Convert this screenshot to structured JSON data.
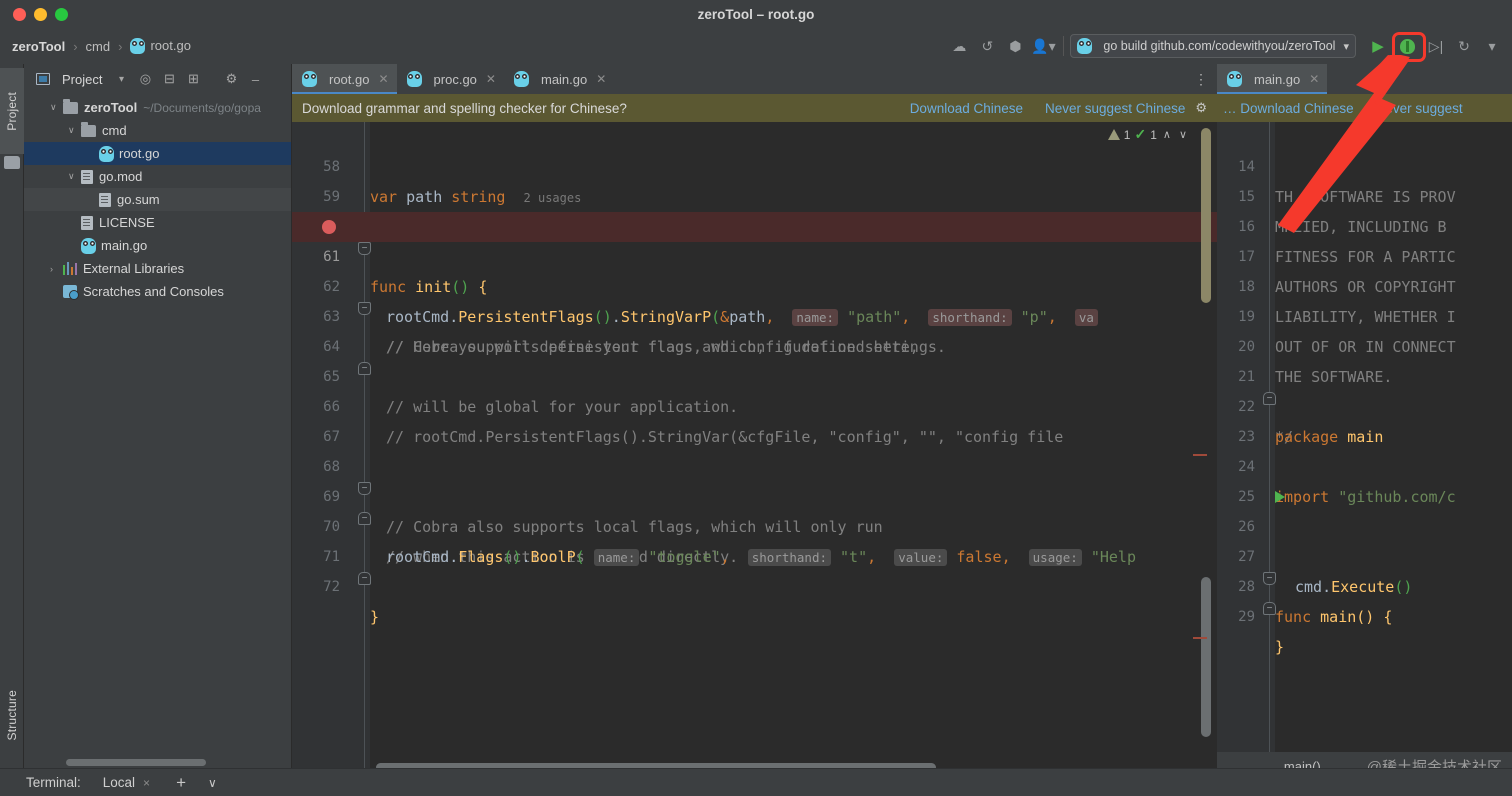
{
  "window": {
    "title": "zeroTool – root.go",
    "traffic_lights": [
      "close",
      "minimize",
      "maximize"
    ]
  },
  "breadcrumb": {
    "items": [
      {
        "label": "zeroTool",
        "icon": "none"
      },
      {
        "label": "cmd",
        "icon": "none"
      },
      {
        "label": "root.go",
        "icon": "go-file-icon"
      }
    ],
    "separator": "›"
  },
  "toolbar": {
    "icons": [
      "cloud-icon",
      "update-project-icon",
      "package-icon",
      "account-icon"
    ],
    "run_config": {
      "label": "go build github.com/codewithyou/zeroTool",
      "icon": "go-file-icon",
      "dropdown": "▾"
    },
    "run_button": "run-button",
    "debug_button": "debug-button",
    "debug_highlighted": true,
    "highlight_color": "#f5392c",
    "run_with_coverage": "coverage-button",
    "profiler": "profiler-button",
    "more_dropdown": "▾"
  },
  "left_strip": {
    "project_tab": "Project",
    "structure_tab": "Structure"
  },
  "project_panel": {
    "title": "Project",
    "header_icons": [
      "project-view-icon",
      "dropdown-icon",
      "locate-icon",
      "expand-all-icon",
      "collapse-all-icon",
      "settings-icon",
      "hide-icon"
    ],
    "tree": [
      {
        "label": "zeroTool",
        "path": "~/Documents/go/gopa",
        "icon": "folder-icon",
        "indent": 0,
        "arrow": "∨",
        "bold": true,
        "state": "normal"
      },
      {
        "label": "cmd",
        "path": "",
        "icon": "folder-icon",
        "indent": 1,
        "arrow": "∨",
        "bold": false,
        "state": "normal"
      },
      {
        "label": "root.go",
        "path": "",
        "icon": "go-file-icon",
        "indent": 2,
        "arrow": "",
        "bold": false,
        "state": "selected"
      },
      {
        "label": "go.mod",
        "path": "",
        "icon": "file-icon",
        "indent": 1,
        "arrow": "∨",
        "bold": false,
        "state": "normal"
      },
      {
        "label": "go.sum",
        "path": "",
        "icon": "file-icon",
        "indent": 2,
        "arrow": "",
        "bold": false,
        "state": "hovered"
      },
      {
        "label": "LICENSE",
        "path": "",
        "icon": "file-icon",
        "indent": 1,
        "arrow": "",
        "bold": false,
        "state": "normal"
      },
      {
        "label": "main.go",
        "path": "",
        "icon": "go-file-icon",
        "indent": 1,
        "arrow": "",
        "bold": false,
        "state": "normal"
      },
      {
        "label": "External Libraries",
        "path": "",
        "icon": "library-icon",
        "indent": 0,
        "arrow": "›",
        "bold": false,
        "state": "normal"
      },
      {
        "label": "Scratches and Consoles",
        "path": "",
        "icon": "scratches-icon",
        "indent": 0,
        "arrow": "",
        "bold": false,
        "state": "normal"
      }
    ]
  },
  "left_editor": {
    "tabs": [
      {
        "label": "root.go",
        "icon": "go-file-icon",
        "active": true
      },
      {
        "label": "proc.go",
        "icon": "go-file-icon",
        "active": false
      },
      {
        "label": "main.go",
        "icon": "go-file-icon",
        "active": false
      }
    ],
    "tab_overflow_menu": "⋮",
    "notification": {
      "message": "Download grammar and spelling checker for Chinese?",
      "actions": [
        "Download Chinese",
        "Never suggest Chinese"
      ],
      "settings_icon": "gear-icon"
    },
    "inspections": {
      "warnings": "1",
      "passed": "1",
      "prev": "∧",
      "next": "∨"
    },
    "first_line_number": 58,
    "lines": [
      {
        "n": 58,
        "fold": "",
        "breakpoint": false,
        "highlight": false
      },
      {
        "n": 59,
        "fold": "",
        "breakpoint": false,
        "highlight": false
      },
      {
        "n": 60,
        "fold": "open",
        "breakpoint": false,
        "highlight": false
      },
      {
        "n": 61,
        "fold": "",
        "breakpoint": true,
        "highlight": true
      },
      {
        "n": 62,
        "fold": "open",
        "breakpoint": false,
        "highlight": false
      },
      {
        "n": 63,
        "fold": "",
        "breakpoint": false,
        "highlight": false
      },
      {
        "n": 64,
        "fold": "close",
        "breakpoint": false,
        "highlight": false
      },
      {
        "n": 65,
        "fold": "",
        "breakpoint": false,
        "highlight": false
      },
      {
        "n": 66,
        "fold": "",
        "breakpoint": false,
        "highlight": false
      },
      {
        "n": 67,
        "fold": "",
        "breakpoint": false,
        "highlight": false
      },
      {
        "n": 68,
        "fold": "open",
        "breakpoint": false,
        "highlight": false
      },
      {
        "n": 69,
        "fold": "close",
        "breakpoint": false,
        "highlight": false
      },
      {
        "n": 70,
        "fold": "",
        "breakpoint": false,
        "highlight": false
      },
      {
        "n": 71,
        "fold": "close",
        "breakpoint": false,
        "highlight": false
      },
      {
        "n": 72,
        "fold": "",
        "breakpoint": false,
        "highlight": false
      }
    ],
    "code_text": {
      "l58": "var path string   2 usages",
      "l60": "func init() {",
      "l61": "rootCmd.PersistentFlags().StringVarP(&path, name: \"path\", shorthand: \"p\", va",
      "l62": "// Here you will define your flags and configuration settings.",
      "l63": "// Cobra supports persistent flags, which, if defined here,",
      "l64": "// will be global for your application.",
      "l66": "// rootCmd.PersistentFlags().StringVar(&cfgFile, \"config\", \"\", \"config file",
      "l68": "// Cobra also supports local flags, which will only run",
      "l69": "// when this action is called directly.",
      "l70": "rootCmd.Flags().BoolP( name: \"toggle\", shorthand: \"t\", value: false, usage: \"Help",
      "l71": "}"
    },
    "hints": {
      "name_path": "name:",
      "path_value": "\"path\"",
      "shorthand": "shorthand:",
      "p_value": "\"p\"",
      "va_partial": "va",
      "toggle_name": "name:",
      "toggle_value": "\"toggle\"",
      "t_value": "\"t\"",
      "value_label": "value:",
      "false_value": "false",
      "usage_label": "usage:",
      "help_partial": "\"Help"
    },
    "status_breadcrumb": ""
  },
  "right_editor": {
    "tabs": [
      {
        "label": "main.go",
        "icon": "go-file-icon",
        "active": true
      }
    ],
    "notification": {
      "message": "…",
      "actions": [
        "Download Chinese",
        "Never suggest"
      ],
      "truncated_prefix": "…"
    },
    "lines": [
      {
        "n": 14,
        "fold": "",
        "run": false
      },
      {
        "n": 15,
        "fold": "",
        "run": false
      },
      {
        "n": 16,
        "fold": "",
        "run": false
      },
      {
        "n": 17,
        "fold": "",
        "run": false
      },
      {
        "n": 18,
        "fold": "",
        "run": false
      },
      {
        "n": 19,
        "fold": "",
        "run": false
      },
      {
        "n": 20,
        "fold": "",
        "run": false
      },
      {
        "n": 21,
        "fold": "close",
        "run": false
      },
      {
        "n": 22,
        "fold": "",
        "run": false
      },
      {
        "n": 23,
        "fold": "",
        "run": false
      },
      {
        "n": 24,
        "fold": "",
        "run": false
      },
      {
        "n": 25,
        "fold": "",
        "run": false
      },
      {
        "n": 26,
        "fold": "open",
        "run": true
      },
      {
        "n": 27,
        "fold": "",
        "run": false
      },
      {
        "n": 28,
        "fold": "close",
        "run": false
      },
      {
        "n": 29,
        "fold": "",
        "run": false
      }
    ],
    "code_text": {
      "l14": "TH  SOFTWARE IS PROV",
      "l15": "MPLIED, INCLUDING B",
      "l16": "FITNESS FOR A PARTIC",
      "l17": "AUTHORS OR COPYRIGHT",
      "l18": "LIABILITY, WHETHER I",
      "l19": "OUT OF OR IN CONNECT",
      "l20": "THE SOFTWARE.",
      "l21": "*/",
      "l22_kw": "package",
      "l22_name": "main",
      "l24_kw": "import",
      "l24_str": "\"github.com/c",
      "l26_kw": "func",
      "l26_fn": "main",
      "l26_rest": "() {",
      "l27": "cmd.Execute()",
      "l28": "}"
    },
    "status_breadcrumb": "main()",
    "watermark": "@稀土掘金技术社区"
  },
  "bottom_bar": {
    "label": "Terminal:",
    "tab": "Local",
    "close_icon": "×",
    "add_icon": "+",
    "dropdown_icon": "∨"
  },
  "annotation": {
    "arrow_color": "#f5392c",
    "points_to": "debug-button"
  }
}
